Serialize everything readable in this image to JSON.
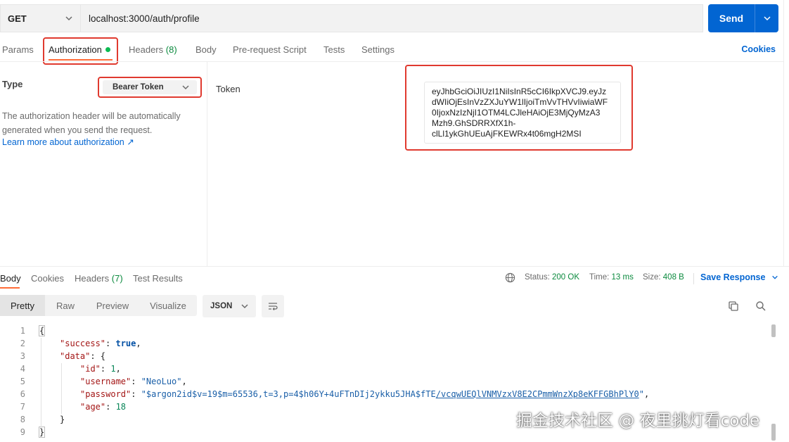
{
  "request": {
    "method": "GET",
    "url": "localhost:3000/auth/profile",
    "send_label": "Send"
  },
  "request_tabs": {
    "params": "Params",
    "authorization": "Authorization",
    "headers": "Headers",
    "headers_count": "(8)",
    "body": "Body",
    "prerequest": "Pre-request Script",
    "tests": "Tests",
    "settings": "Settings",
    "cookies": "Cookies"
  },
  "auth": {
    "type_label": "Type",
    "type_value": "Bearer Token",
    "description": "The authorization header will be automatically generated when you send the request.",
    "learn_more": "Learn more about authorization ↗",
    "token_label": "Token",
    "token_lines": [
      "eyJhbGciOiJIUzI1NiIsInR5cCI6IkpXVCJ9.eyJz",
      "dWIiOjEsInVzZXJuYW1lIjoiTmVvTHVvIiwiaWF",
      "0IjoxNzIzNjI1OTM4LCJleHAiOjE3MjQyMzA3",
      "Mzh9.GhSDRRXfX1h-",
      "clLl1ykGhUEuAjFKEWRx4t06mgH2MSI"
    ]
  },
  "response_tabs": {
    "body": "Body",
    "cookies": "Cookies",
    "headers": "Headers",
    "headers_count": "(7)",
    "test_results": "Test Results",
    "status_label": "Status:",
    "status_value": "200 OK",
    "time_label": "Time:",
    "time_value": "13 ms",
    "size_label": "Size:",
    "size_value": "408 B",
    "save_response": "Save Response"
  },
  "viewer": {
    "modes": [
      "Pretty",
      "Raw",
      "Preview",
      "Visualize"
    ],
    "active_mode": "Pretty",
    "format": "JSON"
  },
  "code": {
    "line_numbers": [
      "1",
      "2",
      "3",
      "4",
      "5",
      "6",
      "7",
      "8",
      "9"
    ],
    "open_brace": "{",
    "success_key": "\"success\"",
    "success_value": "true",
    "data_key": "\"data\"",
    "id_key": "\"id\"",
    "id_value": "1",
    "username_key": "\"username\"",
    "username_value": "\"NeoLuo\"",
    "password_key": "\"password\"",
    "password_value_a": "\"$argon2id$v=19$m=65536,t=3,p=4$h06Y+4uFTnDIj2ykku5JHA$fTE",
    "password_value_b": "/vcqwUEQlVNMVzxV8E2CPmmWnzXp8eKFFGBhPlY0",
    "password_value_c": "\"",
    "age_key": "\"age\"",
    "age_value": "18",
    "close_inner": "}",
    "close_brace": "}"
  },
  "watermark": "掘金技术社区 @ 夜里挑灯看code",
  "colors": {
    "accent_blue": "#0265d2",
    "tab_underline": "#ff6c37",
    "highlight_red": "#e03a2f",
    "status_green": "#0b8a3e"
  }
}
